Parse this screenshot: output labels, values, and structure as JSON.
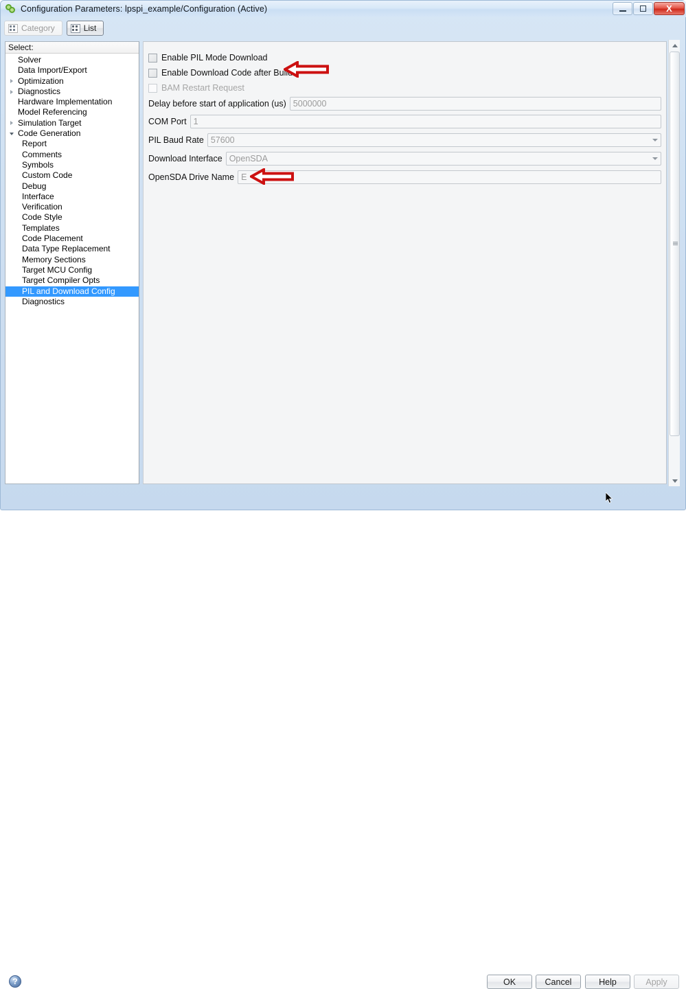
{
  "window": {
    "title": "Configuration Parameters: lpspi_example/Configuration (Active)",
    "icon": "simulink-config-icon",
    "minimize_label": "Minimize",
    "maximize_label": "Maximize",
    "close_label": "X"
  },
  "toolbar": {
    "category_label": "Category",
    "list_label": "List"
  },
  "sidebar": {
    "header": "Select:",
    "items": [
      {
        "label": "Solver",
        "level": 0,
        "arrow": "none",
        "selected": false
      },
      {
        "label": "Data Import/Export",
        "level": 0,
        "arrow": "none",
        "selected": false
      },
      {
        "label": "Optimization",
        "level": 0,
        "arrow": "collapsed",
        "selected": false
      },
      {
        "label": "Diagnostics",
        "level": 0,
        "arrow": "collapsed",
        "selected": false
      },
      {
        "label": "Hardware Implementation",
        "level": 0,
        "arrow": "none",
        "selected": false
      },
      {
        "label": "Model Referencing",
        "level": 0,
        "arrow": "none",
        "selected": false
      },
      {
        "label": "Simulation Target",
        "level": 0,
        "arrow": "collapsed",
        "selected": false
      },
      {
        "label": "Code Generation",
        "level": 0,
        "arrow": "expanded",
        "selected": false
      },
      {
        "label": "Report",
        "level": 1,
        "arrow": "none",
        "selected": false
      },
      {
        "label": "Comments",
        "level": 1,
        "arrow": "none",
        "selected": false
      },
      {
        "label": "Symbols",
        "level": 1,
        "arrow": "none",
        "selected": false
      },
      {
        "label": "Custom Code",
        "level": 1,
        "arrow": "none",
        "selected": false
      },
      {
        "label": "Debug",
        "level": 1,
        "arrow": "none",
        "selected": false
      },
      {
        "label": "Interface",
        "level": 1,
        "arrow": "none",
        "selected": false
      },
      {
        "label": "Verification",
        "level": 1,
        "arrow": "none",
        "selected": false
      },
      {
        "label": "Code Style",
        "level": 1,
        "arrow": "none",
        "selected": false
      },
      {
        "label": "Templates",
        "level": 1,
        "arrow": "none",
        "selected": false
      },
      {
        "label": "Code Placement",
        "level": 1,
        "arrow": "none",
        "selected": false
      },
      {
        "label": "Data Type Replacement",
        "level": 1,
        "arrow": "none",
        "selected": false
      },
      {
        "label": "Memory Sections",
        "level": 1,
        "arrow": "none",
        "selected": false
      },
      {
        "label": "Target MCU Config",
        "level": 1,
        "arrow": "none",
        "selected": false
      },
      {
        "label": "Target Compiler Opts",
        "level": 1,
        "arrow": "none",
        "selected": false
      },
      {
        "label": "PIL and Download Config",
        "level": 1,
        "arrow": "none",
        "selected": true
      },
      {
        "label": "Diagnostics",
        "level": 1,
        "arrow": "none",
        "selected": false
      }
    ]
  },
  "main": {
    "checkboxes": [
      {
        "label": "Enable PIL Mode Download",
        "checked": false,
        "enabled": true
      },
      {
        "label": "Enable Download Code after Build",
        "checked": false,
        "enabled": true
      },
      {
        "label": "BAM Restart Request",
        "checked": false,
        "enabled": false
      }
    ],
    "fields": [
      {
        "label": "Delay before start of application (us)",
        "value": "5000000",
        "type": "text"
      },
      {
        "label": "COM Port",
        "value": "1",
        "type": "text"
      },
      {
        "label": "PIL Baud Rate",
        "value": "57600",
        "type": "combo"
      },
      {
        "label": "Download Interface",
        "value": "OpenSDA",
        "type": "combo"
      },
      {
        "label": "OpenSDA Drive Name",
        "value": "E",
        "type": "text"
      }
    ]
  },
  "annotations": {
    "arrow_color": "#cc1111",
    "arrow1_target": "Enable Download Code after Build",
    "arrow2_target": "OpenSDA Drive Name"
  },
  "footer": {
    "help_icon": "question-mark-icon",
    "ok_label": "OK",
    "cancel_label": "Cancel",
    "help_label": "Help",
    "apply_label": "Apply",
    "apply_enabled": false
  }
}
